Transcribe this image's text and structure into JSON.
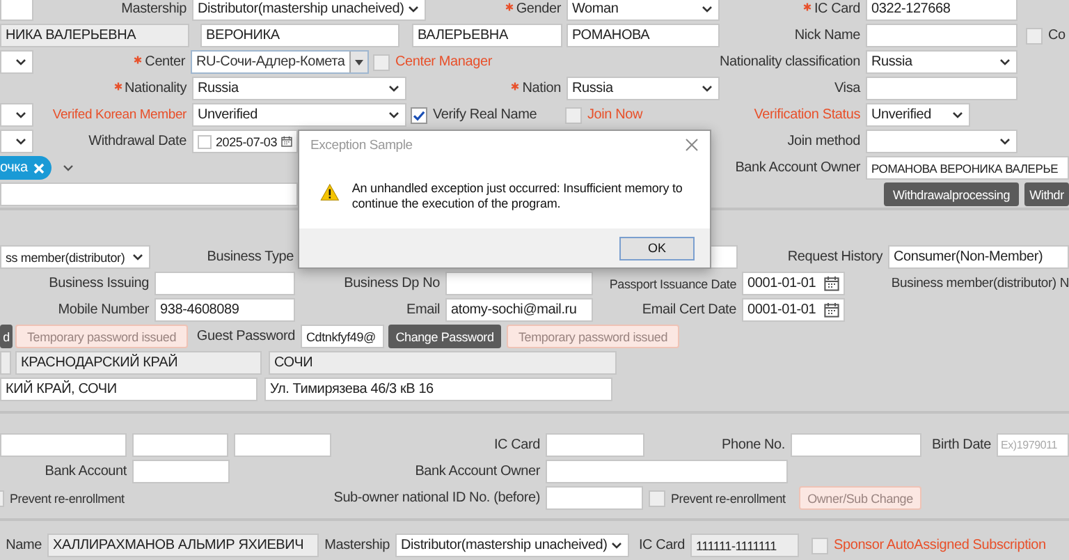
{
  "sections": [
    {
      "rows": [
        {
          "items": [
            {
              "kind": "input",
              "readonly": false
            },
            {
              "kind": "label",
              "text": "Mastership",
              "required": false,
              "warn": false
            },
            {
              "kind": "select",
              "value": "Distributor(mastership unacheived)"
            },
            {
              "kind": "label",
              "text": "Gender",
              "required": true,
              "warn": false
            },
            {
              "kind": "select",
              "value": "Woman"
            },
            {
              "kind": "label",
              "text": "IC Card",
              "required": true,
              "warn": false
            },
            {
              "kind": "input",
              "value": "0322-127668",
              "readonly": false
            }
          ]
        },
        {
          "items": [
            {
              "kind": "input",
              "value": "НИКА ВАЛЕРЬЕВНА",
              "readonly": true
            },
            {
              "kind": "input",
              "value": "ВЕРОНИКА",
              "readonly": false
            },
            {
              "kind": "input",
              "value": "ВАЛЕРЬЕВНА",
              "readonly": false
            },
            {
              "kind": "input",
              "value": "РОМАНОВА",
              "readonly": false
            },
            {
              "kind": "label",
              "text": "Nick Name",
              "required": false,
              "warn": false
            },
            {
              "kind": "input",
              "readonly": false
            },
            {
              "kind": "checkbox",
              "label": "Co",
              "checked": false,
              "warn": false
            }
          ]
        },
        {
          "items": [
            {
              "kind": "select"
            },
            {
              "kind": "label",
              "text": "Center",
              "required": true,
              "warn": false
            },
            {
              "kind": "combo",
              "value": "RU-Сочи-Адлер-Комета"
            },
            {
              "kind": "checkbox",
              "label": "Center Manager",
              "checked": false,
              "warn": true
            },
            {
              "kind": "label",
              "text": "Nationality classification",
              "required": false,
              "warn": false
            },
            {
              "kind": "select",
              "value": "Russia"
            }
          ]
        },
        {
          "items": [
            {
              "kind": "label",
              "text": "Nationality",
              "required": true,
              "warn": false
            },
            {
              "kind": "select",
              "value": "Russia"
            },
            {
              "kind": "label",
              "text": "Nation",
              "required": true,
              "warn": false
            },
            {
              "kind": "select",
              "value": "Russia"
            },
            {
              "kind": "label",
              "text": "Visa",
              "required": false,
              "warn": false
            },
            {
              "kind": "input",
              "readonly": false
            }
          ]
        },
        {
          "items": [
            {
              "kind": "select"
            },
            {
              "kind": "label",
              "text": "Verifed Korean Member",
              "required": false,
              "warn": true
            },
            {
              "kind": "select",
              "value": "Unverified"
            },
            {
              "kind": "checkbox",
              "label": "Verify Real Name",
              "checked": true,
              "warn": false
            },
            {
              "kind": "checkbox",
              "label": "Join Now",
              "checked": false,
              "warn": true
            },
            {
              "kind": "label",
              "text": "Verification Status",
              "required": false,
              "warn": true
            },
            {
              "kind": "select",
              "value": "Unverified"
            }
          ]
        },
        {
          "items": [
            {
              "kind": "select"
            },
            {
              "kind": "label",
              "text": "Withdrawal Date",
              "required": false,
              "warn": false
            },
            {
              "kind": "checkdate",
              "value": "2025-07-03",
              "checked": false
            },
            {
              "kind": "label",
              "text": "Join method",
              "required": false,
              "warn": false
            },
            {
              "kind": "select"
            }
          ]
        },
        {
          "items": [
            {
              "kind": "tags",
              "tag": "очка"
            },
            {
              "kind": "label",
              "text": "Bank Account Owner",
              "required": false,
              "warn": false
            },
            {
              "kind": "input",
              "value": "РОМАНОВА ВЕРОНИКА ВАЛЕРЬЕ",
              "readonly": false
            }
          ]
        },
        {
          "items": [
            {
              "kind": "input",
              "readonly": false
            },
            {
              "kind": "button",
              "label": "Withdrawalprocessing",
              "disabled": false
            },
            {
              "kind": "button",
              "label": "Withdr",
              "disabled": false
            }
          ]
        }
      ]
    },
    {
      "rows": [
        {
          "items": [
            {
              "kind": "select",
              "value": "ss member(distributor)"
            },
            {
              "kind": "label",
              "text": "Business Type",
              "required": false,
              "warn": false
            },
            {
              "kind": "input",
              "readonly": false
            },
            {
              "kind": "label",
              "text": "Request History",
              "required": false,
              "warn": false
            },
            {
              "kind": "select",
              "value": "Consumer(Non-Member)"
            }
          ]
        },
        {
          "items": [
            {
              "kind": "label",
              "text": "Business Issuing",
              "required": false,
              "warn": false
            },
            {
              "kind": "input",
              "readonly": false
            },
            {
              "kind": "label",
              "text": "Business Dp No",
              "required": false,
              "warn": false
            },
            {
              "kind": "input",
              "readonly": false
            },
            {
              "kind": "label",
              "text": "Passport Issuance Date",
              "required": false,
              "warn": false
            },
            {
              "kind": "date",
              "value": "0001-01-01"
            },
            {
              "kind": "label",
              "text": "Business member(distributor) N",
              "required": false,
              "warn": false
            }
          ]
        },
        {
          "items": [
            {
              "kind": "label",
              "text": "Mobile Number",
              "required": false,
              "warn": false
            },
            {
              "kind": "input",
              "value": "938-4608089",
              "readonly": false
            },
            {
              "kind": "label",
              "text": "Email",
              "required": false,
              "warn": false
            },
            {
              "kind": "input",
              "value": "atomy-sochi@mail.ru",
              "readonly": false
            },
            {
              "kind": "label",
              "text": "Email Cert Date",
              "required": false,
              "warn": false
            },
            {
              "kind": "date",
              "value": "0001-01-01"
            }
          ]
        },
        {
          "items": [
            {
              "kind": "button",
              "label": "d",
              "disabled": false
            },
            {
              "kind": "button",
              "label": "Temporary password issued",
              "disabled": true
            },
            {
              "kind": "label",
              "text": "Guest Password",
              "required": false,
              "warn": false
            },
            {
              "kind": "input",
              "value": "Cdtnkfyf49@",
              "readonly": false
            },
            {
              "kind": "button",
              "label": "Change Password",
              "disabled": false
            },
            {
              "kind": "button",
              "label": "Temporary password issued",
              "disabled": true
            }
          ]
        },
        {
          "items": [
            {
              "kind": "input",
              "readonly": true
            },
            {
              "kind": "input",
              "value": "КРАСНОДАРСКИЙ КРАЙ",
              "readonly": true
            },
            {
              "kind": "input",
              "value": "СОЧИ",
              "readonly": true
            }
          ]
        },
        {
          "items": [
            {
              "kind": "input",
              "value": "КИЙ КРАЙ, СОЧИ",
              "readonly": false
            },
            {
              "kind": "input",
              "value": "Ул. Тимирязева 46/3 кВ 16",
              "readonly": false
            }
          ]
        }
      ]
    },
    {
      "rows": [
        {
          "items": [
            {
              "kind": "input",
              "readonly": false
            },
            {
              "kind": "input",
              "readonly": false
            },
            {
              "kind": "input",
              "readonly": false
            },
            {
              "kind": "label",
              "text": "IC Card",
              "required": false,
              "warn": false
            },
            {
              "kind": "input",
              "readonly": false
            },
            {
              "kind": "label",
              "text": "Phone No.",
              "required": false,
              "warn": false
            },
            {
              "kind": "input",
              "readonly": false
            },
            {
              "kind": "label",
              "text": "Birth Date",
              "required": false,
              "warn": false
            },
            {
              "kind": "input",
              "placeholder": "Ex)1979011",
              "readonly": false
            }
          ]
        },
        {
          "items": [
            {
              "kind": "label",
              "text": "Bank Account",
              "required": false,
              "warn": false
            },
            {
              "kind": "input",
              "readonly": false
            },
            {
              "kind": "label",
              "text": "Bank Account Owner",
              "required": false,
              "warn": false
            },
            {
              "kind": "input",
              "readonly": false
            }
          ]
        },
        {
          "items": [
            {
              "kind": "checkbox",
              "label": "Prevent re-enrollment",
              "checked": false,
              "warn": false
            },
            {
              "kind": "label",
              "text": "Sub-owner national ID No. (before)",
              "required": false,
              "warn": false
            },
            {
              "kind": "input",
              "readonly": false
            },
            {
              "kind": "checkbox",
              "label": "Prevent re-enrollment",
              "checked": false,
              "warn": false
            },
            {
              "kind": "button",
              "label": "Owner/Sub Change",
              "disabled": true
            }
          ]
        }
      ]
    },
    {
      "rows": [
        {
          "items": [
            {
              "kind": "label",
              "text": "Name",
              "required": false,
              "warn": false
            },
            {
              "kind": "input",
              "value": "ХАЛЛИРАХМАНОВ АЛЬМИР ЯХИЕВИЧ",
              "readonly": true
            },
            {
              "kind": "label",
              "text": "Mastership",
              "required": false,
              "warn": false
            },
            {
              "kind": "select",
              "value": "Distributor(mastership unacheived)"
            },
            {
              "kind": "label",
              "text": "IC Card",
              "required": false,
              "warn": false
            },
            {
              "kind": "input",
              "value": "111111-1111111",
              "readonly": true
            },
            {
              "kind": "checkbox",
              "label": "Sponsor AutoAssigned Subscription",
              "checked": false,
              "warn": true
            }
          ]
        }
      ]
    }
  ],
  "dialog": {
    "title": "Exception Sample",
    "message": "An unhandled exception just occurred: Insufficient memory to continue the execution of the program.",
    "button": "OK"
  }
}
